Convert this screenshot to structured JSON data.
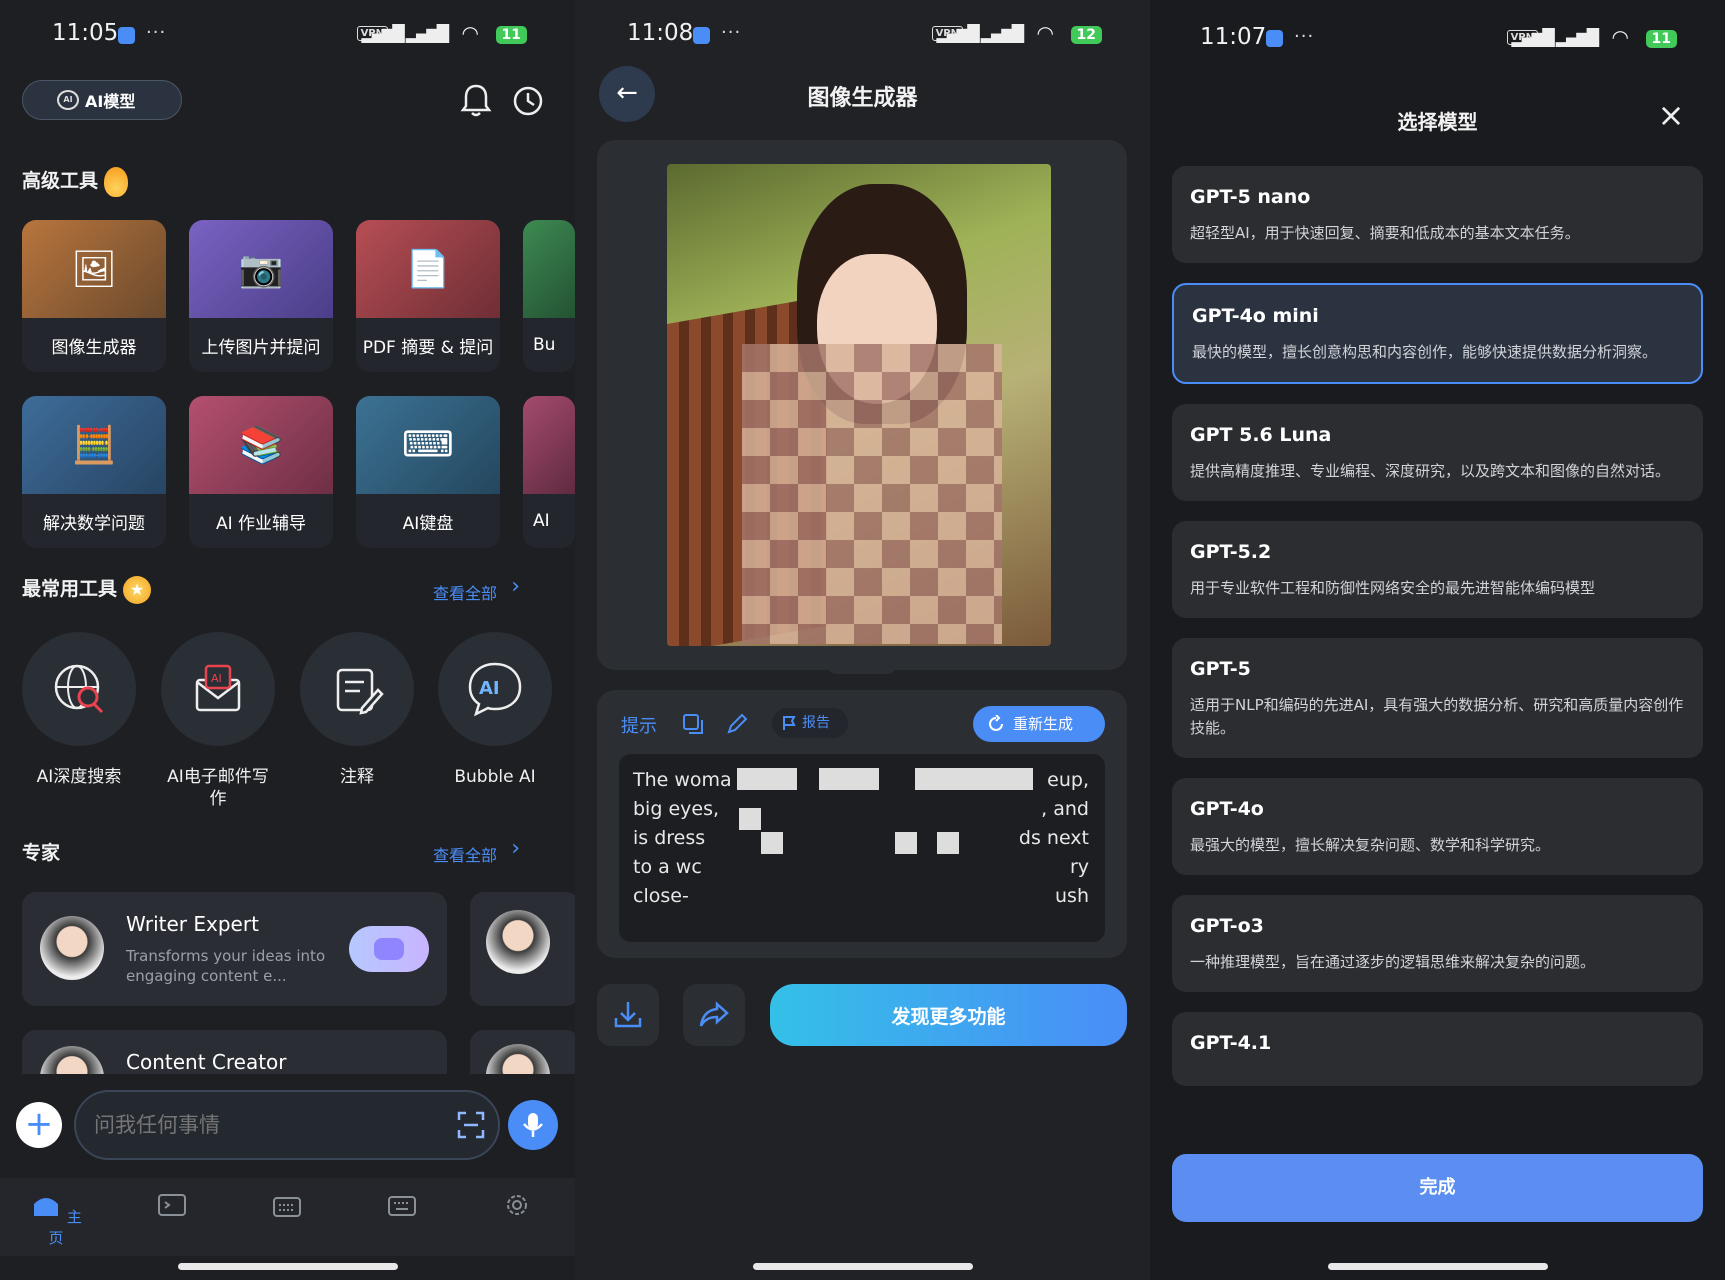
{
  "status_left": {
    "time": "11:05",
    "battery": "11"
  },
  "status_mid": {
    "time": "11:08",
    "battery": "12"
  },
  "status_right": {
    "time": "11:07",
    "battery": "11"
  },
  "status_common": {
    "more": "···",
    "vpn": "VPN"
  },
  "home": {
    "chip_label": "AI模型",
    "advanced_title": "高级工具",
    "tools": [
      {
        "label": "图像生成器"
      },
      {
        "label": "上传图片并提问"
      },
      {
        "label": "PDF 摘要 & 提问"
      },
      {
        "label": "Bu"
      },
      {
        "label": "解决数学问题"
      },
      {
        "label": "AI 作业辅导"
      },
      {
        "label": "AI键盘"
      },
      {
        "label": "AI"
      }
    ],
    "frequent_title": "最常用工具",
    "view_all": "查看全部",
    "frequent": [
      {
        "label": "AI深度搜索"
      },
      {
        "label": "AI电子邮件写作"
      },
      {
        "label": "注释"
      },
      {
        "label": "Bubble AI"
      }
    ],
    "experts_title": "专家",
    "experts": [
      {
        "name": "Writer Expert",
        "desc": "Transforms your ideas into engaging content e..."
      },
      {
        "name": "Content Creator"
      }
    ],
    "input_placeholder": "问我任何事情",
    "nav": [
      {
        "label": "主页"
      }
    ]
  },
  "generator": {
    "title": "图像生成器",
    "prompt_tab": "提示",
    "report": "报告",
    "regenerate": "重新生成",
    "prompt_lines": [
      "The woma",
      "big eyes,",
      "is dress",
      "to a wc",
      "close-"
    ],
    "prompt_right": [
      "eup,",
      ", and",
      "ds next",
      "ry",
      "ush"
    ],
    "discover": "发现更多功能"
  },
  "models": {
    "title": "选择模型",
    "list": [
      {
        "name": "GPT-5 nano",
        "desc": "超轻型AI，用于快速回复、摘要和低成本的基本文本任务。"
      },
      {
        "name": "GPT-4o mini",
        "desc": "最快的模型，擅长创意构思和内容创作，能够快速提供数据分析洞察。"
      },
      {
        "name": "GPT 5.6 Luna",
        "desc": "提供高精度推理、专业编程、深度研究，以及跨文本和图像的自然对话。"
      },
      {
        "name": "GPT-5.2",
        "desc": "用于专业软件工程和防御性网络安全的最先进智能体编码模型"
      },
      {
        "name": "GPT-5",
        "desc": "适用于NLP和编码的先进AI，具有强大的数据分析、研究和高质量内容创作技能。"
      },
      {
        "name": "GPT-4o",
        "desc": "最强大的模型，擅长解决复杂问题、数学和科学研究。"
      },
      {
        "name": "GPT-o3",
        "desc": "一种推理模型，旨在通过逐步的逻辑思维来解决复杂的问题。"
      },
      {
        "name": "GPT-4.1",
        "desc": ""
      }
    ],
    "selected_index": 1,
    "done": "完成"
  },
  "colors": {
    "accent": "#4a8df7",
    "battery": "#41c95a"
  }
}
